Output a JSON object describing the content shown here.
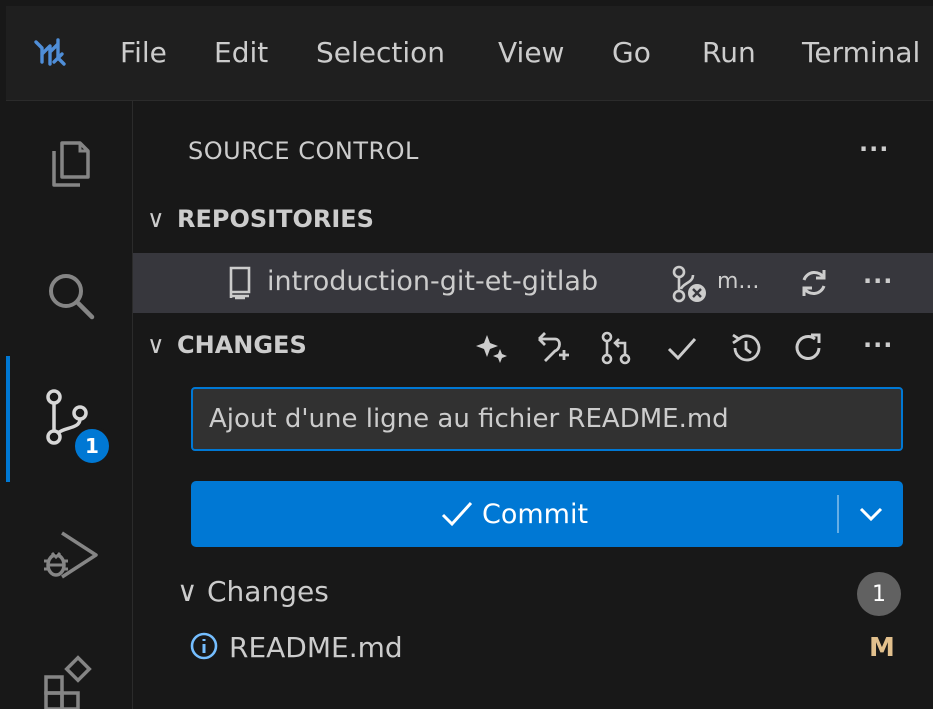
{
  "menu": {
    "items": [
      "File",
      "Edit",
      "Selection",
      "View",
      "Go",
      "Run",
      "Terminal"
    ]
  },
  "activity": {
    "scm_badge": "1"
  },
  "sidebar": {
    "title": "SOURCE CONTROL",
    "more": "···",
    "repositories_header": "REPOSITORIES",
    "repo": {
      "name": "introduction-git-et-gitlab",
      "branch": "m...",
      "more": "···"
    },
    "changes_header": "CHANGES",
    "changes_more": "···",
    "commit_message": "Ajout d'une ligne au fichier README.md",
    "commit_label": "Commit",
    "group": {
      "label": "Changes",
      "count": "1"
    },
    "files": [
      {
        "name": "README.md",
        "status": "M"
      }
    ]
  },
  "colors": {
    "accent": "#0078d4",
    "modified": "#e2c08d",
    "selected_row": "#37373d"
  }
}
